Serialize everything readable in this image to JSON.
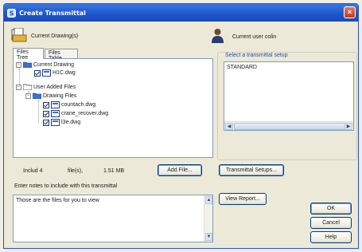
{
  "window": {
    "title": "Create Transmittal",
    "close_glyph": "×"
  },
  "header": {
    "drawings_label": "Current Drawing(s)",
    "user_label": "Current user colin"
  },
  "tabs": [
    {
      "label": "Files Tree",
      "active": true
    },
    {
      "label": "Files Table",
      "active": false
    }
  ],
  "tree": {
    "current_drawing": "Current Drawing",
    "current_file": "H1C.dwg",
    "user_added": "User Added Files",
    "drawing_files": "Drawing Files",
    "files": [
      "countach.dwg",
      "crane_recover.dwg",
      "l3e.dwg"
    ]
  },
  "summary": {
    "included": "Includ 4",
    "files": "file(s),",
    "size": "1.51 MB"
  },
  "buttons": {
    "add_file": "Add File...",
    "transmittal_setups": "Transmittal Setups...",
    "view_report": "View Report...",
    "ok": "OK",
    "cancel": "Cancel",
    "help": "Help"
  },
  "setup": {
    "group_label": "Select a transmittal setup",
    "items": [
      "STANDARD"
    ]
  },
  "notes": {
    "label": "Enter notes to include with this transmittal",
    "value": "Those are the files for you to view"
  },
  "colors": {
    "title_bar": "#1c54c8",
    "accent": "#1f4fb0",
    "close": "#c53a18"
  },
  "icons": [
    "app-icon",
    "drawings-icon",
    "user-icon",
    "folder-icon",
    "file-icon",
    "checkbox-icon",
    "close-icon"
  ]
}
